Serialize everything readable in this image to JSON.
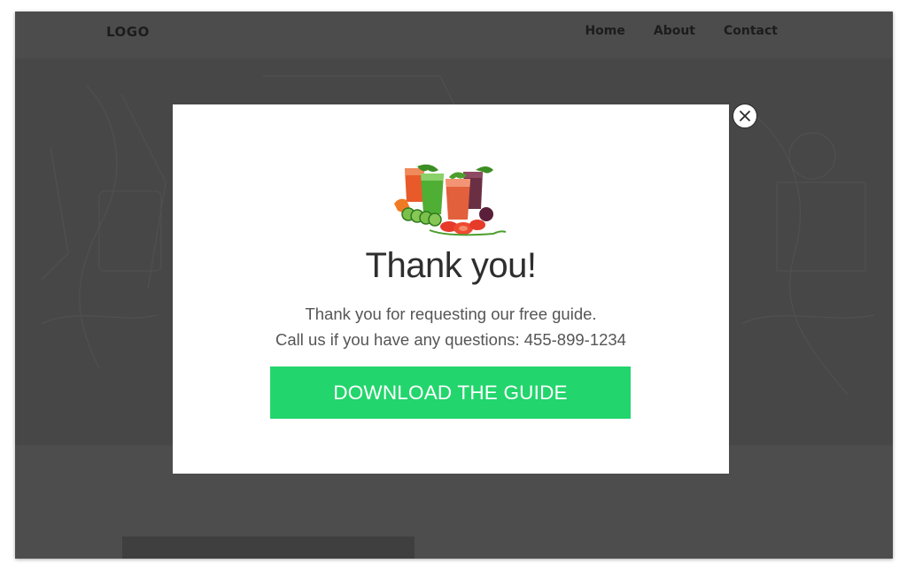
{
  "header": {
    "logo": "LOGO",
    "nav": [
      "Home",
      "About",
      "Contact"
    ]
  },
  "modal": {
    "image_alt": "glasses of vegetable juice with sliced vegetables",
    "title": "Thank you!",
    "lines": [
      "Thank you for requesting our free guide.",
      "Call us if you have any questions: 455-899-1234"
    ],
    "cta_label": "DOWNLOAD THE GUIDE",
    "close_icon": "close-x-icon"
  },
  "colors": {
    "overlay": "#4a4a4a",
    "cta": "#22d56c",
    "modal_bg": "#ffffff",
    "text_dark": "#2e2e2e",
    "text_muted": "#555555"
  }
}
